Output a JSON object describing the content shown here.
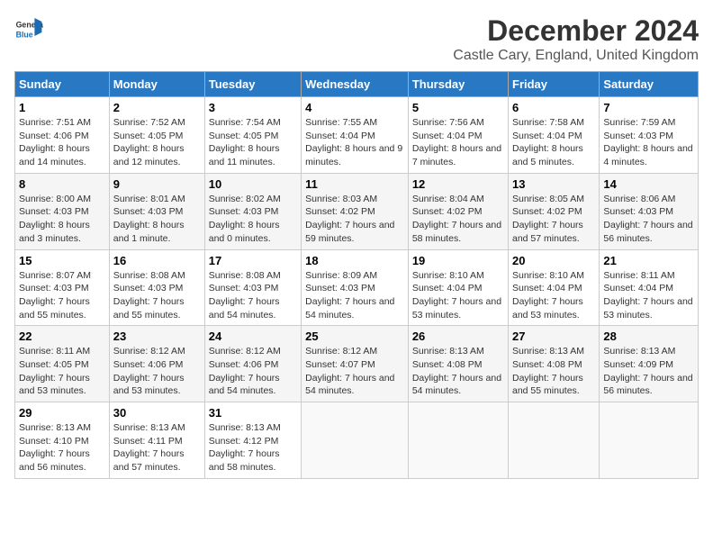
{
  "logo": {
    "line1": "General",
    "line2": "Blue"
  },
  "title": "December 2024",
  "subtitle": "Castle Cary, England, United Kingdom",
  "days_header": [
    "Sunday",
    "Monday",
    "Tuesday",
    "Wednesday",
    "Thursday",
    "Friday",
    "Saturday"
  ],
  "weeks": [
    [
      {
        "day": "1",
        "sunrise": "7:51 AM",
        "sunset": "4:06 PM",
        "daylight": "8 hours and 14 minutes."
      },
      {
        "day": "2",
        "sunrise": "7:52 AM",
        "sunset": "4:05 PM",
        "daylight": "8 hours and 12 minutes."
      },
      {
        "day": "3",
        "sunrise": "7:54 AM",
        "sunset": "4:05 PM",
        "daylight": "8 hours and 11 minutes."
      },
      {
        "day": "4",
        "sunrise": "7:55 AM",
        "sunset": "4:04 PM",
        "daylight": "8 hours and 9 minutes."
      },
      {
        "day": "5",
        "sunrise": "7:56 AM",
        "sunset": "4:04 PM",
        "daylight": "8 hours and 7 minutes."
      },
      {
        "day": "6",
        "sunrise": "7:58 AM",
        "sunset": "4:04 PM",
        "daylight": "8 hours and 5 minutes."
      },
      {
        "day": "7",
        "sunrise": "7:59 AM",
        "sunset": "4:03 PM",
        "daylight": "8 hours and 4 minutes."
      }
    ],
    [
      {
        "day": "8",
        "sunrise": "8:00 AM",
        "sunset": "4:03 PM",
        "daylight": "8 hours and 3 minutes."
      },
      {
        "day": "9",
        "sunrise": "8:01 AM",
        "sunset": "4:03 PM",
        "daylight": "8 hours and 1 minute."
      },
      {
        "day": "10",
        "sunrise": "8:02 AM",
        "sunset": "4:03 PM",
        "daylight": "8 hours and 0 minutes."
      },
      {
        "day": "11",
        "sunrise": "8:03 AM",
        "sunset": "4:02 PM",
        "daylight": "7 hours and 59 minutes."
      },
      {
        "day": "12",
        "sunrise": "8:04 AM",
        "sunset": "4:02 PM",
        "daylight": "7 hours and 58 minutes."
      },
      {
        "day": "13",
        "sunrise": "8:05 AM",
        "sunset": "4:02 PM",
        "daylight": "7 hours and 57 minutes."
      },
      {
        "day": "14",
        "sunrise": "8:06 AM",
        "sunset": "4:03 PM",
        "daylight": "7 hours and 56 minutes."
      }
    ],
    [
      {
        "day": "15",
        "sunrise": "8:07 AM",
        "sunset": "4:03 PM",
        "daylight": "7 hours and 55 minutes."
      },
      {
        "day": "16",
        "sunrise": "8:08 AM",
        "sunset": "4:03 PM",
        "daylight": "7 hours and 55 minutes."
      },
      {
        "day": "17",
        "sunrise": "8:08 AM",
        "sunset": "4:03 PM",
        "daylight": "7 hours and 54 minutes."
      },
      {
        "day": "18",
        "sunrise": "8:09 AM",
        "sunset": "4:03 PM",
        "daylight": "7 hours and 54 minutes."
      },
      {
        "day": "19",
        "sunrise": "8:10 AM",
        "sunset": "4:04 PM",
        "daylight": "7 hours and 53 minutes."
      },
      {
        "day": "20",
        "sunrise": "8:10 AM",
        "sunset": "4:04 PM",
        "daylight": "7 hours and 53 minutes."
      },
      {
        "day": "21",
        "sunrise": "8:11 AM",
        "sunset": "4:04 PM",
        "daylight": "7 hours and 53 minutes."
      }
    ],
    [
      {
        "day": "22",
        "sunrise": "8:11 AM",
        "sunset": "4:05 PM",
        "daylight": "7 hours and 53 minutes."
      },
      {
        "day": "23",
        "sunrise": "8:12 AM",
        "sunset": "4:06 PM",
        "daylight": "7 hours and 53 minutes."
      },
      {
        "day": "24",
        "sunrise": "8:12 AM",
        "sunset": "4:06 PM",
        "daylight": "7 hours and 54 minutes."
      },
      {
        "day": "25",
        "sunrise": "8:12 AM",
        "sunset": "4:07 PM",
        "daylight": "7 hours and 54 minutes."
      },
      {
        "day": "26",
        "sunrise": "8:13 AM",
        "sunset": "4:08 PM",
        "daylight": "7 hours and 54 minutes."
      },
      {
        "day": "27",
        "sunrise": "8:13 AM",
        "sunset": "4:08 PM",
        "daylight": "7 hours and 55 minutes."
      },
      {
        "day": "28",
        "sunrise": "8:13 AM",
        "sunset": "4:09 PM",
        "daylight": "7 hours and 56 minutes."
      }
    ],
    [
      {
        "day": "29",
        "sunrise": "8:13 AM",
        "sunset": "4:10 PM",
        "daylight": "7 hours and 56 minutes."
      },
      {
        "day": "30",
        "sunrise": "8:13 AM",
        "sunset": "4:11 PM",
        "daylight": "7 hours and 57 minutes."
      },
      {
        "day": "31",
        "sunrise": "8:13 AM",
        "sunset": "4:12 PM",
        "daylight": "7 hours and 58 minutes."
      },
      null,
      null,
      null,
      null
    ]
  ],
  "labels": {
    "sunrise": "Sunrise:",
    "sunset": "Sunset:",
    "daylight": "Daylight:"
  }
}
